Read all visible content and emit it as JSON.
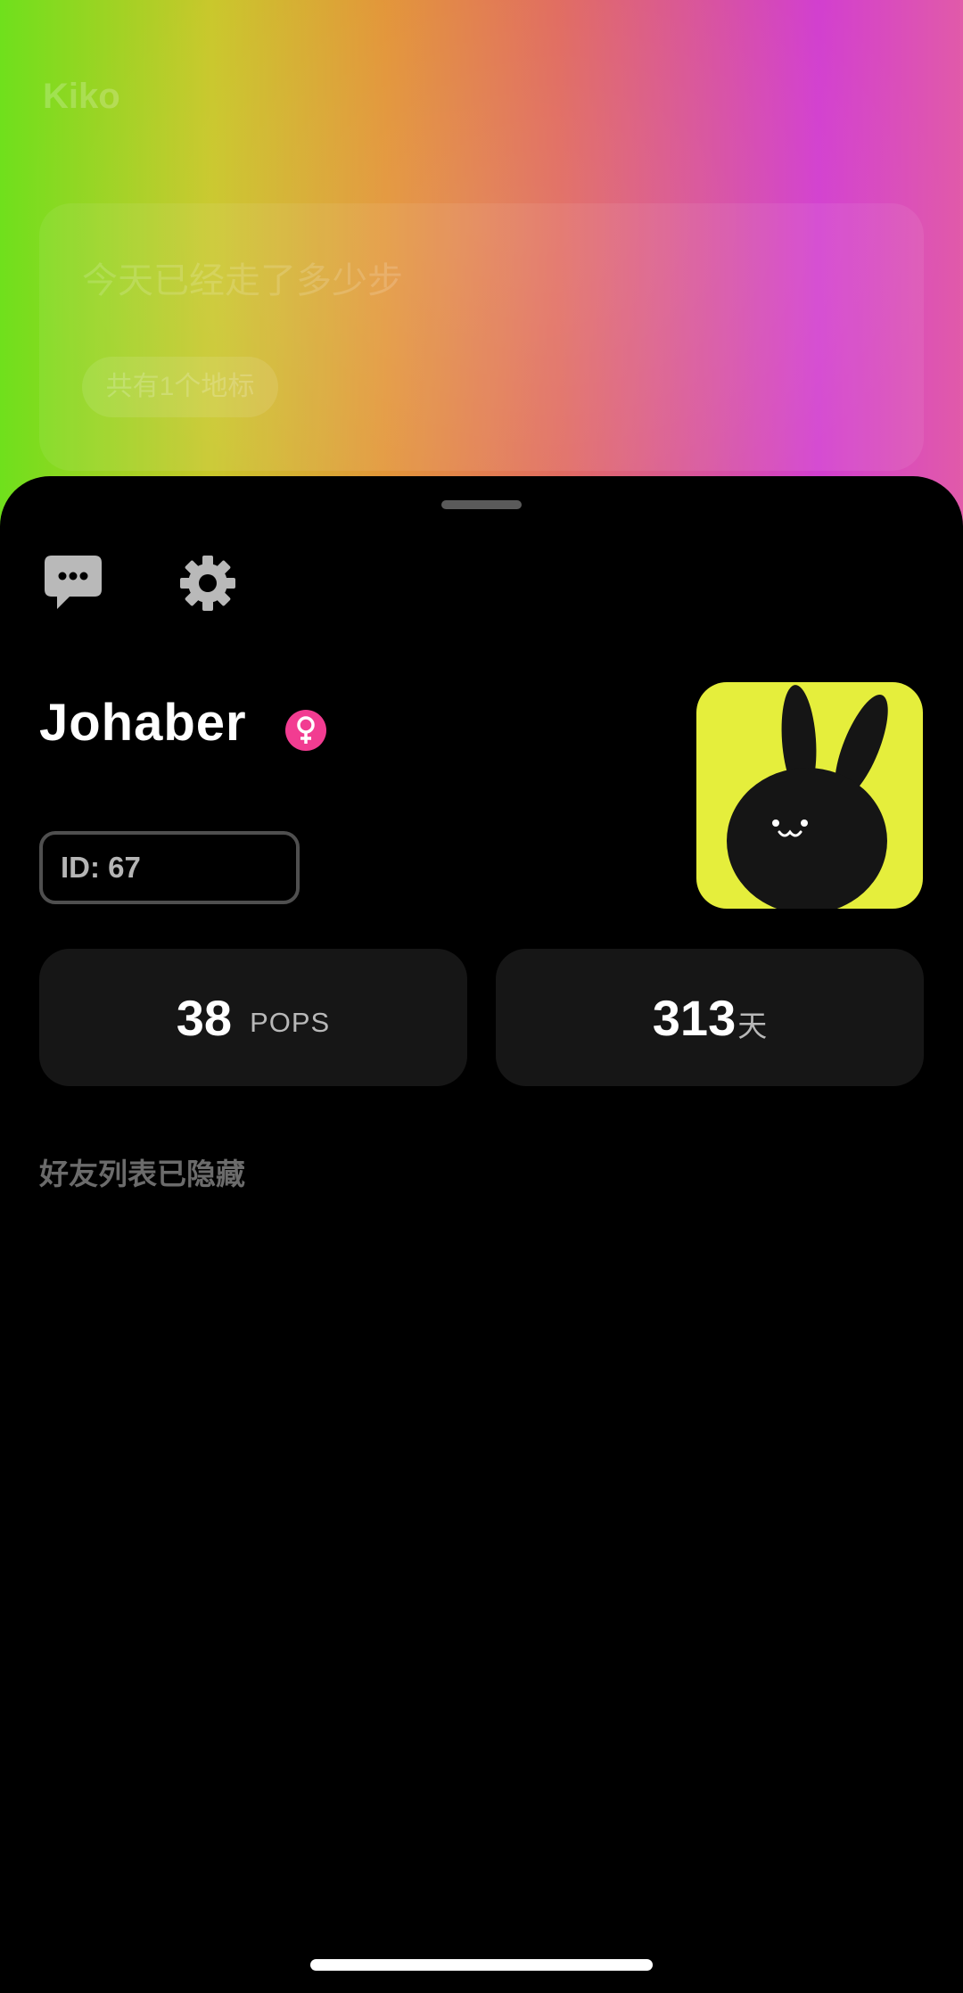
{
  "background": {
    "title": "Kiko",
    "card_text": "今天已经走了多少步",
    "card_chip": "共有1个地标",
    "gradient": [
      "#6fe01c",
      "#c9c72a",
      "#e29436",
      "#e06a5e",
      "#d74fa4",
      "#d23fcf"
    ]
  },
  "toolbar": {
    "chat_icon": "chat-bubble-icon",
    "settings_icon": "gear-icon"
  },
  "profile": {
    "name": "Johaber",
    "gender_icon": "female-icon",
    "gender_color": "#f23c91",
    "id_text": "ID: 67",
    "avatar_icon": "black-bunny-avatar",
    "avatar_bg": "#e5ee3c"
  },
  "stats": {
    "pops_value": "38",
    "pops_unit": "POPS",
    "days_value": "313",
    "days_unit": "天"
  },
  "friends": {
    "hidden_notice": "好友列表已隐藏"
  }
}
